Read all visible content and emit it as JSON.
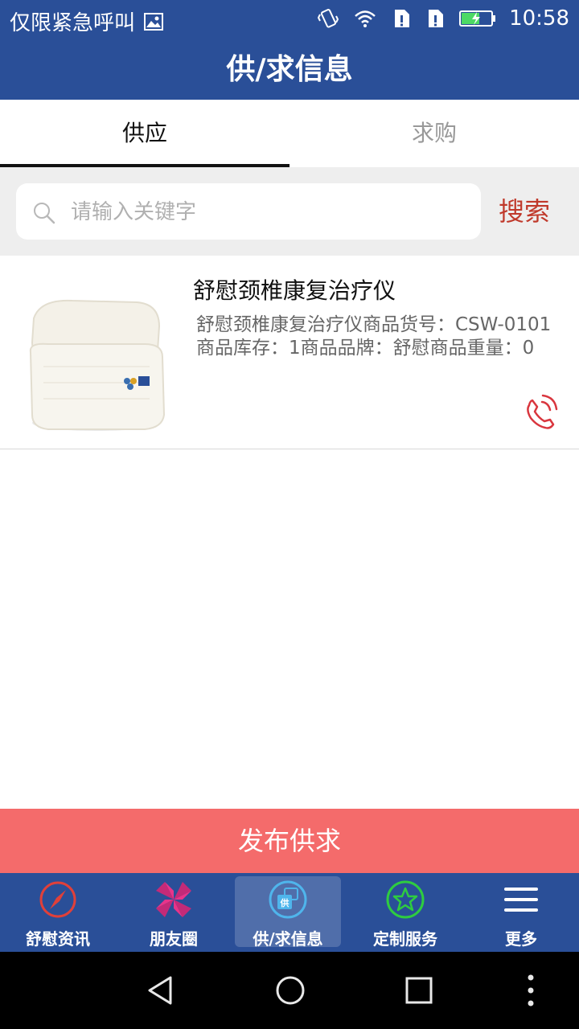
{
  "status_bar": {
    "carrier_text": "仅限紧急呼叫",
    "time": "10:58",
    "icons": [
      "image-icon",
      "vibrate-icon",
      "wifi-icon",
      "sim1-icon",
      "sim2-icon",
      "battery-charging-icon"
    ]
  },
  "header": {
    "title": "供/求信息"
  },
  "tabs": [
    {
      "label": "供应",
      "active": true
    },
    {
      "label": "求购",
      "active": false
    }
  ],
  "search": {
    "placeholder": "请输入关键字",
    "value": "",
    "button_label": "搜索"
  },
  "list": [
    {
      "title": "舒慰颈椎康复治疗仪",
      "description": "舒慰颈椎康复治疗仪商品货号：CSW-0101商品库存：1商品品牌：舒慰商品重量：0",
      "image_icon": "pillow-product-image",
      "call_icon": "phone-call-icon"
    }
  ],
  "publish_button": {
    "label": "发布供求"
  },
  "bottom_nav": [
    {
      "label": "舒慰资讯",
      "icon": "compass-icon",
      "active": false
    },
    {
      "label": "朋友圈",
      "icon": "pinwheel-icon",
      "active": false
    },
    {
      "label": "供/求信息",
      "icon": "supply-demand-icon",
      "active": true
    },
    {
      "label": "定制服务",
      "icon": "star-icon",
      "active": false
    },
    {
      "label": "更多",
      "icon": "menu-icon",
      "active": false
    }
  ],
  "colors": {
    "brand_blue": "#2a4f98",
    "accent_red": "#c0392b",
    "publish_bg": "#f46b6b"
  }
}
